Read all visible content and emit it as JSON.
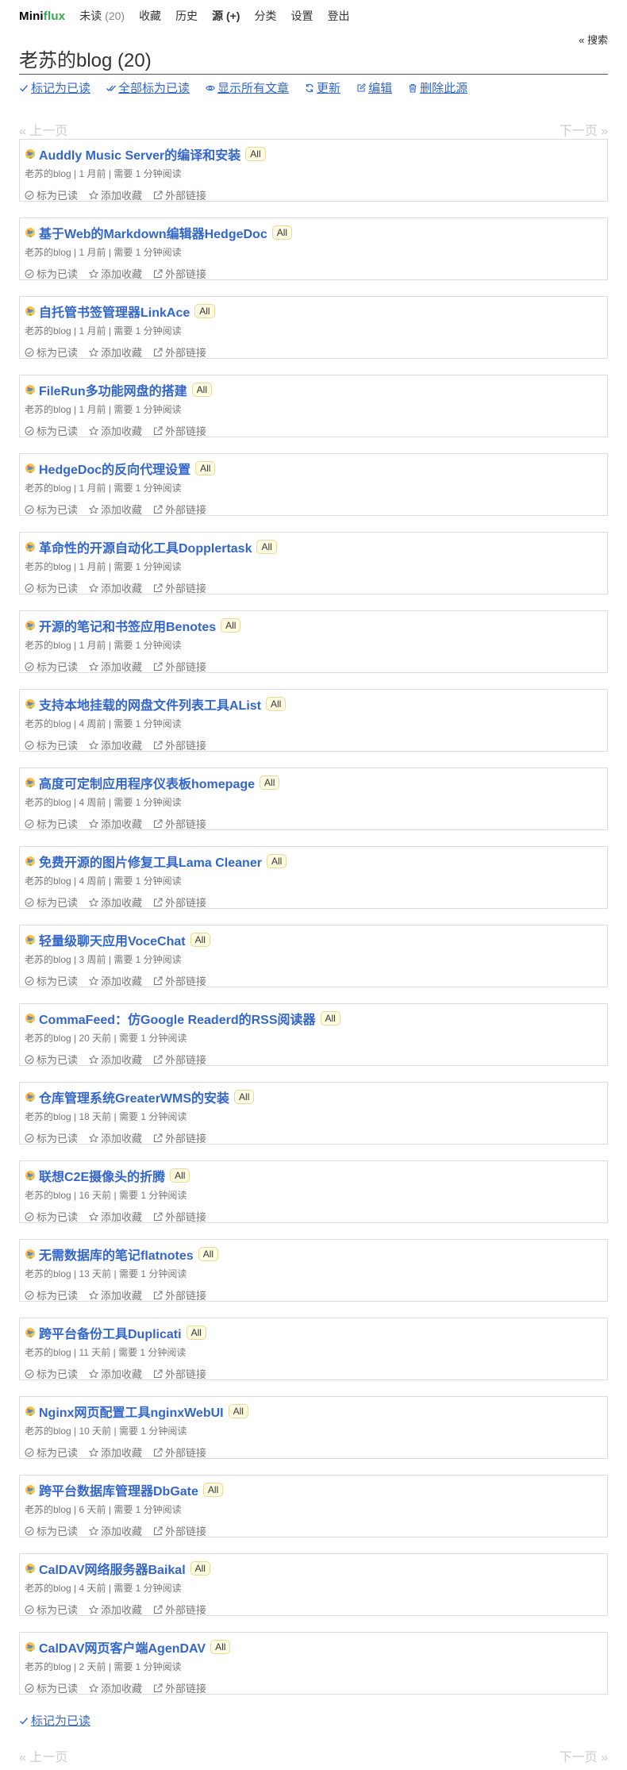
{
  "nav": {
    "logo_a": "Mini",
    "logo_b": "flux",
    "unread": "未读",
    "unread_count": "(20)",
    "starred": "收藏",
    "history": "历史",
    "feeds": "源",
    "feeds_add": "(+)",
    "categories": "分类",
    "settings": "设置",
    "logout": "登出"
  },
  "search_label": "« 搜索",
  "page": {
    "title": "老苏的blog (20)",
    "actions": {
      "mark_read": "标记为已读",
      "mark_all_read": "全部标为已读",
      "show_all": "显示所有文章",
      "refresh": "更新",
      "edit": "编辑",
      "delete": "删除此源"
    }
  },
  "pagination": {
    "prev": "« 上一页",
    "next": "下一页 »"
  },
  "entry_actions": {
    "mark_read": "标为已读",
    "star": "添加收藏",
    "external": "外部链接"
  },
  "entries": [
    {
      "title": "Auddly Music Server的编译和安装",
      "category": "All",
      "feed": "老苏的blog",
      "age": "1 月前",
      "reading": "需要 1 分钟阅读"
    },
    {
      "title": "基于Web的Markdown编辑器HedgeDoc",
      "category": "All",
      "feed": "老苏的blog",
      "age": "1 月前",
      "reading": "需要 1 分钟阅读"
    },
    {
      "title": "自托管书签管理器LinkAce",
      "category": "All",
      "feed": "老苏的blog",
      "age": "1 月前",
      "reading": "需要 1 分钟阅读"
    },
    {
      "title": "FileRun多功能网盘的搭建",
      "category": "All",
      "feed": "老苏的blog",
      "age": "1 月前",
      "reading": "需要 1 分钟阅读"
    },
    {
      "title": "HedgeDoc的反向代理设置",
      "category": "All",
      "feed": "老苏的blog",
      "age": "1 月前",
      "reading": "需要 1 分钟阅读"
    },
    {
      "title": "革命性的开源自动化工具Dopplertask",
      "category": "All",
      "feed": "老苏的blog",
      "age": "1 月前",
      "reading": "需要 1 分钟阅读"
    },
    {
      "title": "开源的笔记和书签应用Benotes",
      "category": "All",
      "feed": "老苏的blog",
      "age": "1 月前",
      "reading": "需要 1 分钟阅读"
    },
    {
      "title": "支持本地挂载的网盘文件列表工具AList",
      "category": "All",
      "feed": "老苏的blog",
      "age": "4 周前",
      "reading": "需要 1 分钟阅读"
    },
    {
      "title": "高度可定制应用程序仪表板homepage",
      "category": "All",
      "feed": "老苏的blog",
      "age": "4 周前",
      "reading": "需要 1 分钟阅读"
    },
    {
      "title": "免费开源的图片修复工具Lama Cleaner",
      "category": "All",
      "feed": "老苏的blog",
      "age": "4 周前",
      "reading": "需要 1 分钟阅读"
    },
    {
      "title": "轻量级聊天应用VoceChat",
      "category": "All",
      "feed": "老苏的blog",
      "age": "3 周前",
      "reading": "需要 1 分钟阅读"
    },
    {
      "title": "CommaFeed：仿Google Readerd的RSS阅读器",
      "category": "All",
      "feed": "老苏的blog",
      "age": "20 天前",
      "reading": "需要 1 分钟阅读"
    },
    {
      "title": "仓库管理系统GreaterWMS的安装",
      "category": "All",
      "feed": "老苏的blog",
      "age": "18 天前",
      "reading": "需要 1 分钟阅读"
    },
    {
      "title": "联想C2E摄像头的折腾",
      "category": "All",
      "feed": "老苏的blog",
      "age": "16 天前",
      "reading": "需要 1 分钟阅读"
    },
    {
      "title": "无需数据库的笔记flatnotes",
      "category": "All",
      "feed": "老苏的blog",
      "age": "13 天前",
      "reading": "需要 1 分钟阅读"
    },
    {
      "title": "跨平台备份工具Duplicati",
      "category": "All",
      "feed": "老苏的blog",
      "age": "11 天前",
      "reading": "需要 1 分钟阅读"
    },
    {
      "title": "Nginx网页配置工具nginxWebUI",
      "category": "All",
      "feed": "老苏的blog",
      "age": "10 天前",
      "reading": "需要 1 分钟阅读"
    },
    {
      "title": "跨平台数据库管理器DbGate",
      "category": "All",
      "feed": "老苏的blog",
      "age": "6 天前",
      "reading": "需要 1 分钟阅读"
    },
    {
      "title": "CalDAV网络服务器Baikal",
      "category": "All",
      "feed": "老苏的blog",
      "age": "4 天前",
      "reading": "需要 1 分钟阅读"
    },
    {
      "title": "CalDAV网页客户端AgenDAV",
      "category": "All",
      "feed": "老苏的blog",
      "age": "2 天前",
      "reading": "需要 1 分钟阅读"
    }
  ],
  "bottom": {
    "mark_read": "标记为已读"
  }
}
